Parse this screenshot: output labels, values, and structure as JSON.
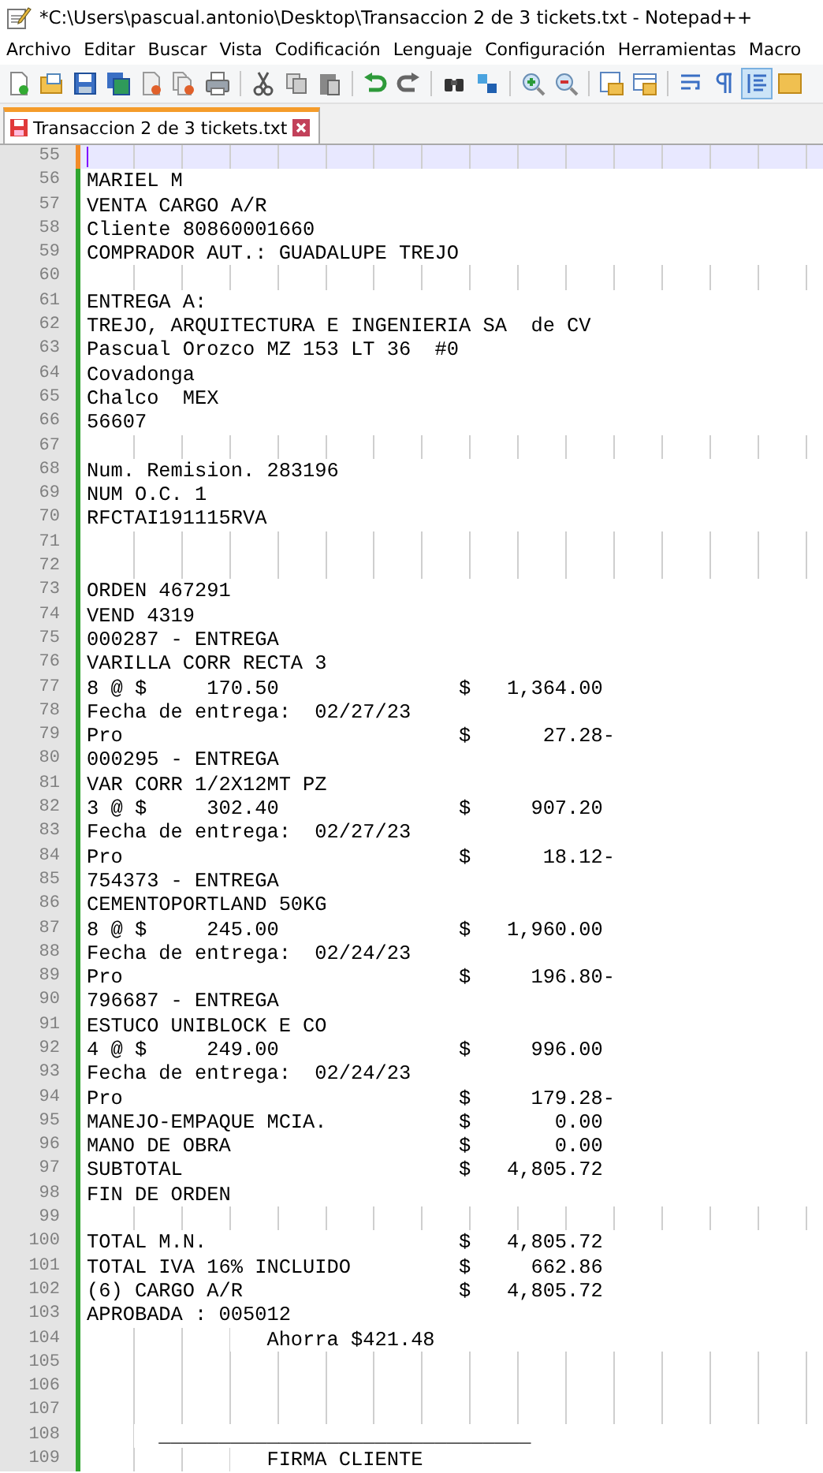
{
  "window": {
    "title": "*C:\\Users\\pascual.antonio\\Desktop\\Transaccion 2 de 3 tickets.txt - Notepad++"
  },
  "menu": [
    "Archivo",
    "Editar",
    "Buscar",
    "Vista",
    "Codificación",
    "Lenguaje",
    "Configuración",
    "Herramientas",
    "Macro"
  ],
  "tabs": [
    {
      "label": "Transaccion 2 de 3 tickets.txt",
      "selected": true,
      "modified": true
    }
  ],
  "editor": {
    "lines": [
      {
        "number": "55",
        "current": true,
        "modified": true
      },
      {
        "number": "56",
        "text": "MARIEL M",
        "current": false,
        "modified": false
      },
      {
        "number": "57",
        "text": "VENTA CARGO A/R",
        "current": false,
        "modified": false
      },
      {
        "number": "58",
        "text": "Cliente 80860001660",
        "current": false,
        "modified": false
      },
      {
        "number": "59",
        "text": "COMPRADOR AUT.: GUADALUPE TREJO",
        "current": false,
        "modified": false
      },
      {
        "number": "60",
        "current": false,
        "modified": false
      },
      {
        "number": "61",
        "text": "ENTREGA A:",
        "current": false,
        "modified": false
      },
      {
        "number": "62",
        "text": "TREJO, ARQUITECTURA E INGENIERIA SA  de CV",
        "current": false,
        "modified": false
      },
      {
        "number": "63",
        "text": "Pascual Orozco MZ 153 LT 36  #0",
        "current": false,
        "modified": false
      },
      {
        "number": "64",
        "text": "Covadonga",
        "current": false,
        "modified": false
      },
      {
        "number": "65",
        "text": "Chalco  MEX",
        "current": false,
        "modified": false
      },
      {
        "number": "66",
        "text": "56607",
        "current": false,
        "modified": false
      },
      {
        "number": "67",
        "current": false,
        "modified": false
      },
      {
        "number": "68",
        "text": "Num. Remision. 283196",
        "current": false,
        "modified": false
      },
      {
        "number": "69",
        "text": "NUM O.C. 1",
        "current": false,
        "modified": false
      },
      {
        "number": "70",
        "text": "RFCTAI191115RVA",
        "current": false,
        "modified": false
      },
      {
        "number": "71",
        "current": false,
        "modified": false
      },
      {
        "number": "72",
        "current": false,
        "modified": false
      },
      {
        "number": "73",
        "text": "ORDEN 467291",
        "current": false,
        "modified": false
      },
      {
        "number": "74",
        "text": "VEND 4319",
        "current": false,
        "modified": false
      },
      {
        "number": "75",
        "text": "000287 - ENTREGA",
        "current": false,
        "modified": false
      },
      {
        "number": "76",
        "text": "VARILLA CORR RECTA 3",
        "current": false,
        "modified": false
      },
      {
        "number": "77",
        "text": "8 @ $     170.50               $   1,364.00",
        "current": false,
        "modified": false
      },
      {
        "number": "78",
        "text": "Fecha de entrega:  02/27/23",
        "current": false,
        "modified": false
      },
      {
        "number": "79",
        "text": "Pro                            $      27.28-",
        "current": false,
        "modified": false
      },
      {
        "number": "80",
        "text": "000295 - ENTREGA",
        "current": false,
        "modified": false
      },
      {
        "number": "81",
        "text": "VAR CORR 1/2X12MT PZ",
        "current": false,
        "modified": false
      },
      {
        "number": "82",
        "text": "3 @ $     302.40               $     907.20",
        "current": false,
        "modified": false
      },
      {
        "number": "83",
        "text": "Fecha de entrega:  02/27/23",
        "current": false,
        "modified": false
      },
      {
        "number": "84",
        "text": "Pro                            $      18.12-",
        "current": false,
        "modified": false
      },
      {
        "number": "85",
        "text": "754373 - ENTREGA",
        "current": false,
        "modified": false
      },
      {
        "number": "86",
        "text": "CEMENTOPORTLAND 50KG",
        "current": false,
        "modified": false
      },
      {
        "number": "87",
        "text": "8 @ $     245.00               $   1,960.00",
        "current": false,
        "modified": false
      },
      {
        "number": "88",
        "text": "Fecha de entrega:  02/24/23",
        "current": false,
        "modified": false
      },
      {
        "number": "89",
        "text": "Pro                            $     196.80-",
        "current": false,
        "modified": false
      },
      {
        "number": "90",
        "text": "796687 - ENTREGA",
        "current": false,
        "modified": false
      },
      {
        "number": "91",
        "text": "ESTUCO UNIBLOCK E CO",
        "current": false,
        "modified": false
      },
      {
        "number": "92",
        "text": "4 @ $     249.00               $     996.00",
        "current": false,
        "modified": false
      },
      {
        "number": "93",
        "text": "Fecha de entrega:  02/24/23",
        "current": false,
        "modified": false
      },
      {
        "number": "94",
        "text": "Pro                            $     179.28-",
        "current": false,
        "modified": false
      },
      {
        "number": "95",
        "text": "MANEJO-EMPAQUE MCIA.           $       0.00",
        "current": false,
        "modified": false
      },
      {
        "number": "96",
        "text": "MANO DE OBRA                   $       0.00",
        "current": false,
        "modified": false
      },
      {
        "number": "97",
        "text": "SUBTOTAL                       $   4,805.72",
        "current": false,
        "modified": false
      },
      {
        "number": "98",
        "text": "FIN DE ORDEN",
        "current": false,
        "modified": false
      },
      {
        "number": "99",
        "current": false,
        "modified": false
      },
      {
        "number": "100",
        "text": "TOTAL M.N.                     $   4,805.72",
        "current": false,
        "modified": false
      },
      {
        "number": "101",
        "text": "TOTAL IVA 16% INCLUIDO         $     662.86",
        "current": false,
        "modified": false
      },
      {
        "number": "102",
        "text": "(6) CARGO A/R                  $   4,805.72",
        "current": false,
        "modified": false
      },
      {
        "number": "103",
        "text": "APROBADA : 005012",
        "current": false,
        "modified": false
      },
      {
        "number": "104",
        "text": "               Ahorra $421.48",
        "current": false,
        "modified": false
      },
      {
        "number": "105",
        "current": false,
        "modified": false
      },
      {
        "number": "106",
        "current": false,
        "modified": false
      },
      {
        "number": "107",
        "current": false,
        "modified": false
      },
      {
        "number": "108",
        "text": "      _______________________________",
        "current": false,
        "modified": false
      },
      {
        "number": "109",
        "text": "               FIRMA CLIENTE",
        "current": false,
        "modified": false
      }
    ]
  }
}
